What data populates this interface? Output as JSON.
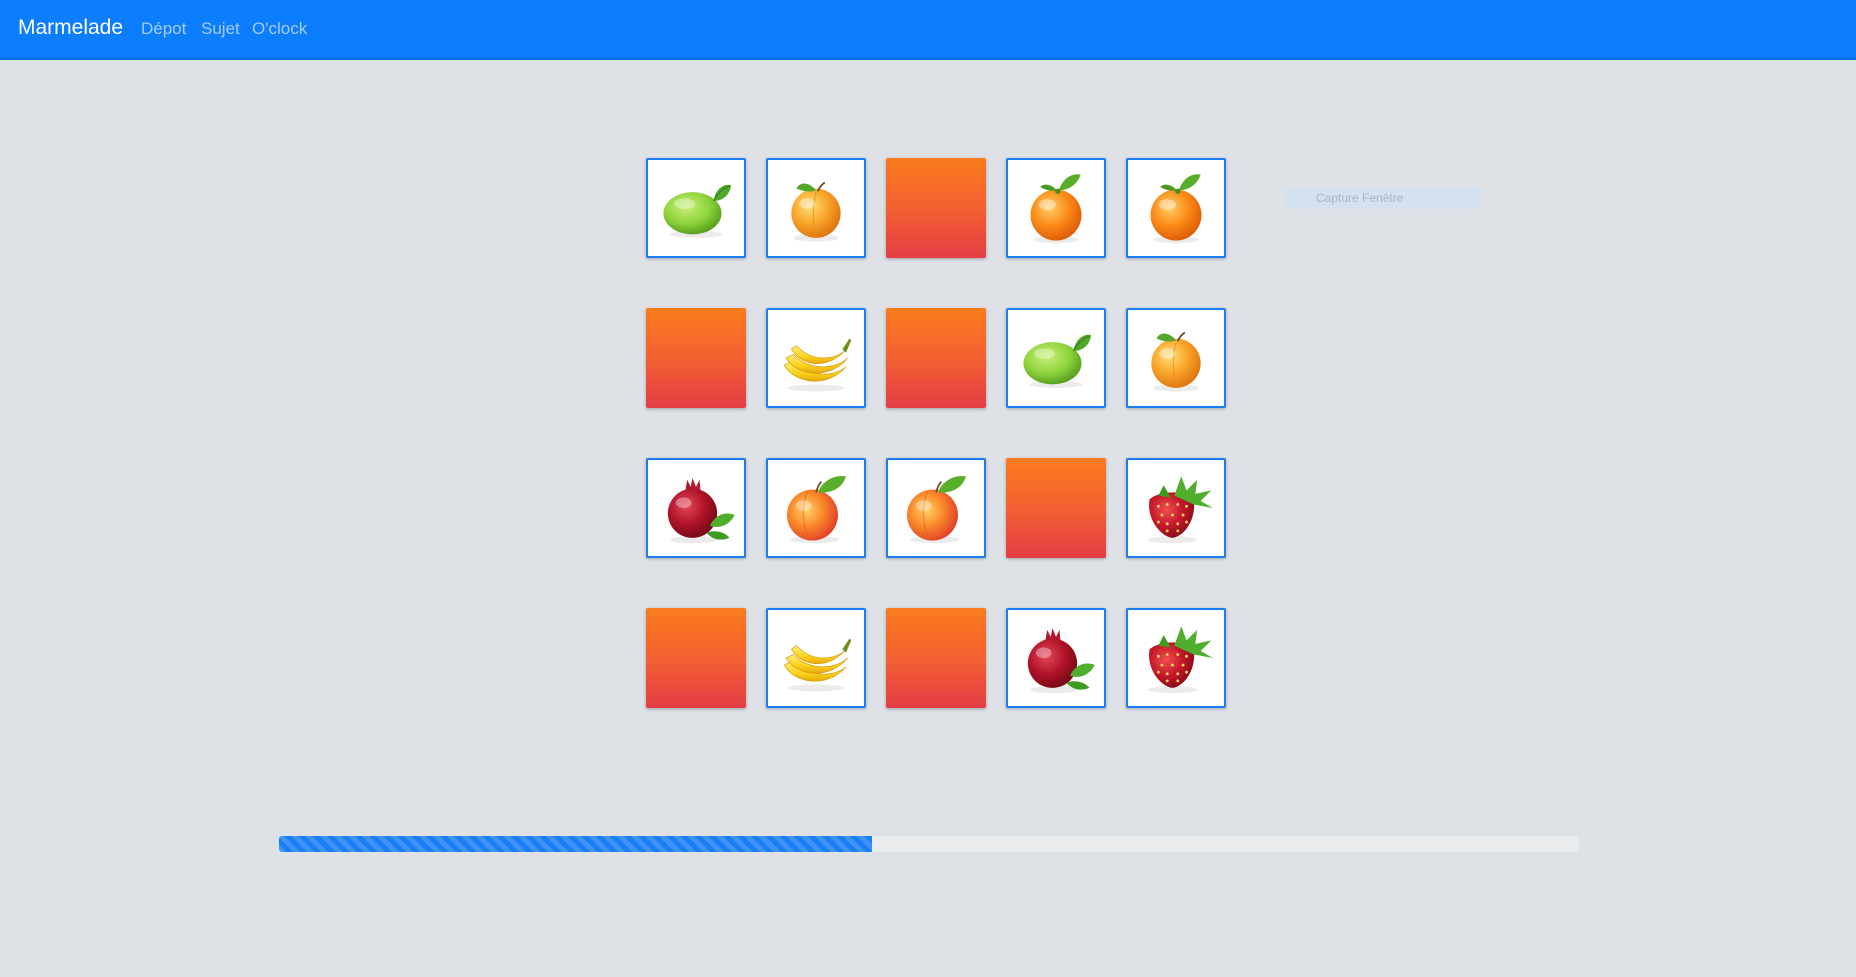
{
  "navbar": {
    "brand": "Marmelade",
    "links": [
      "Dépot",
      "Sujet",
      "O'clock"
    ]
  },
  "board": {
    "rows": [
      [
        "lime",
        "apricot",
        "hidden",
        "orange",
        "orange"
      ],
      [
        "hidden",
        "banana",
        "hidden",
        "lime",
        "apricot"
      ],
      [
        "pomegranate",
        "peach",
        "peach",
        "hidden",
        "strawberry"
      ],
      [
        "hidden",
        "banana",
        "hidden",
        "pomegranate",
        "strawberry"
      ]
    ]
  },
  "capture_button": {
    "label": "Capture Fenêtre"
  },
  "timer": {
    "progress": 0.456,
    "color": "#1a7ef6"
  },
  "colors": {
    "navbar": "#0b7dfd",
    "card_border": "#1b7ef3",
    "card_back_top": "#fb7c1d",
    "card_back_bottom": "#e43d45"
  }
}
